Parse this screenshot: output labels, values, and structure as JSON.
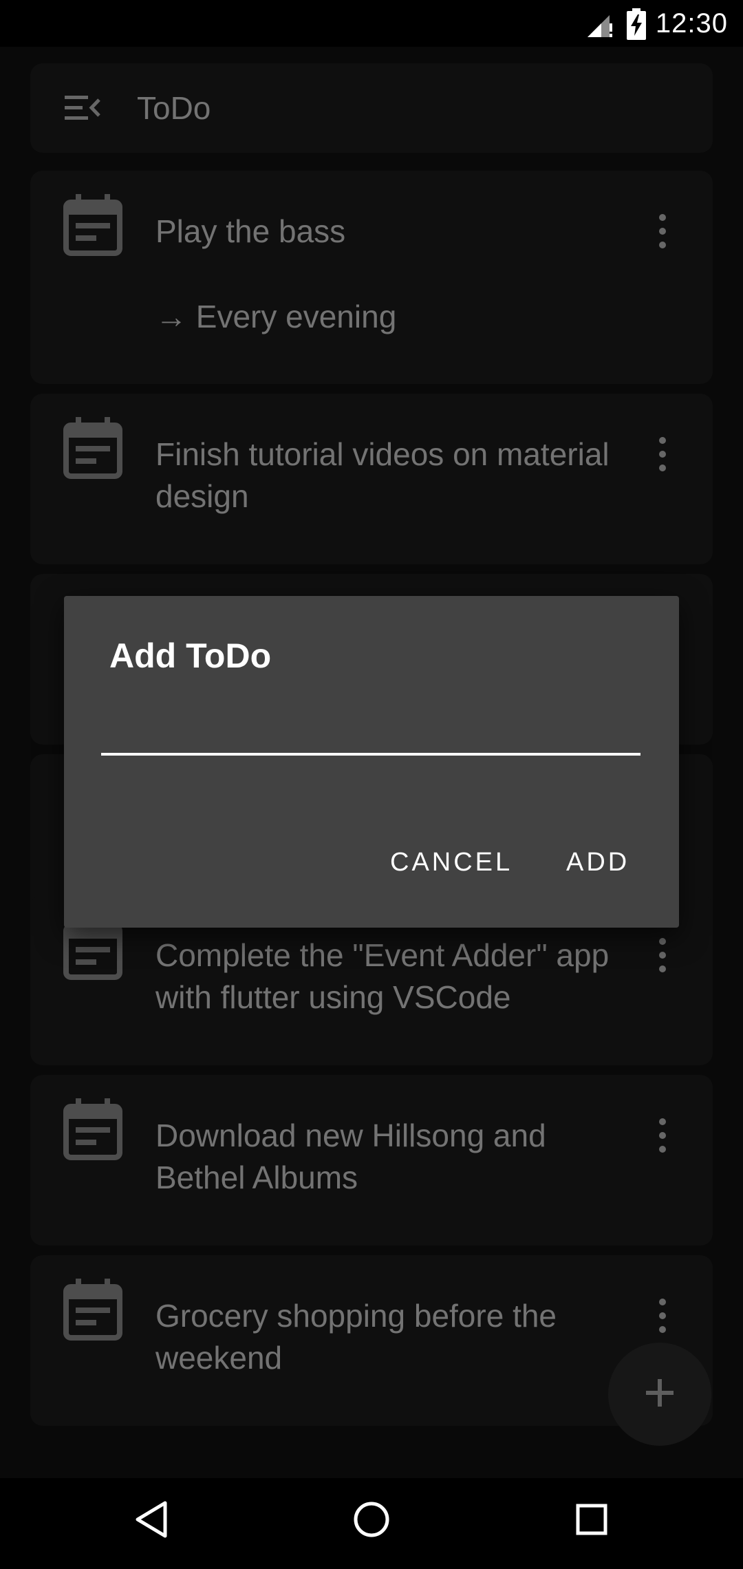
{
  "status_bar": {
    "time": "12:30",
    "icons": [
      "signal-icon",
      "battery-charging-icon"
    ]
  },
  "app_bar": {
    "title": "ToDo",
    "menu_icon": "menu-collapse-icon"
  },
  "todos": [
    {
      "title": "Play the bass",
      "subtitle": "→ Every evening"
    },
    {
      "title": "Finish tutorial videos on material design"
    },
    {
      "title": ""
    },
    {
      "title": ""
    },
    {
      "title": "Complete the \"Event Adder\" app with flutter using VSCode"
    },
    {
      "title": "Download new Hillsong and Bethel Albums"
    },
    {
      "title": "Grocery shopping before the weekend"
    }
  ],
  "fab": {
    "icon": "plus-icon"
  },
  "dialog": {
    "title": "Add ToDo",
    "input_value": "",
    "cancel_label": "CANCEL",
    "add_label": "ADD"
  },
  "nav_bar": {
    "icons": [
      "back-icon",
      "home-icon",
      "recents-icon"
    ]
  },
  "colors": {
    "background": "#121212",
    "card": "#1e1e1e",
    "dialog": "#424242",
    "text": "#e6e6e6"
  }
}
